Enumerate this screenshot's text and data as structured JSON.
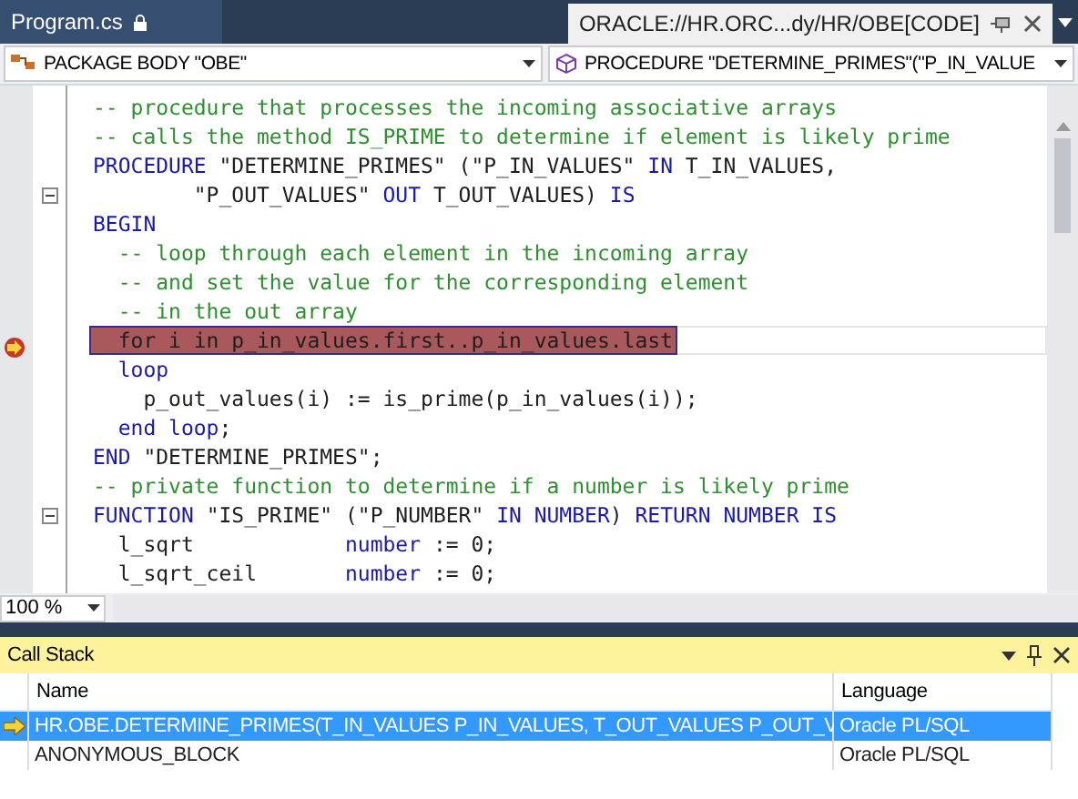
{
  "tabs": [
    {
      "label": "Program.cs",
      "selected": false,
      "locked": true
    },
    {
      "label": "ORACLE://HR.ORC...dy/HR/OBE[CODE]",
      "selected": true,
      "locked": false
    }
  ],
  "navigation": {
    "left": "PACKAGE BODY \"OBE\"",
    "right": "PROCEDURE \"DETERMINE_PRIMES\"(\"P_IN_VALUE"
  },
  "code_lines": [
    {
      "tokens": [
        {
          "kind": "comment",
          "text": "-- procedure that processes the incoming associative arrays"
        }
      ]
    },
    {
      "tokens": [
        {
          "kind": "comment",
          "text": "-- calls the method IS_PRIME to determine if element is likely prime"
        }
      ]
    },
    {
      "tokens": [
        {
          "kind": "keyword",
          "text": "PROCEDURE"
        },
        {
          "kind": "plain",
          "text": " \"DETERMINE_PRIMES\" (\"P_IN_VALUES\" "
        },
        {
          "kind": "keyword",
          "text": "IN"
        },
        {
          "kind": "plain",
          "text": " T_IN_VALUES,"
        }
      ]
    },
    {
      "fold": true,
      "tokens": [
        {
          "kind": "plain",
          "text": "        \"P_OUT_VALUES\" "
        },
        {
          "kind": "keyword",
          "text": "OUT"
        },
        {
          "kind": "plain",
          "text": " T_OUT_VALUES) "
        },
        {
          "kind": "keyword",
          "text": "IS"
        }
      ]
    },
    {
      "tokens": [
        {
          "kind": "keyword",
          "text": "BEGIN"
        }
      ]
    },
    {
      "tokens": [
        {
          "kind": "comment",
          "text": "  -- loop through each element in the incoming array"
        }
      ]
    },
    {
      "tokens": [
        {
          "kind": "comment",
          "text": "  -- and set the value for the corresponding element"
        }
      ]
    },
    {
      "tokens": [
        {
          "kind": "comment",
          "text": "  -- in the out array"
        }
      ]
    },
    {
      "current": true,
      "tokens": [
        {
          "kind": "plain",
          "text": "  for i in p_in_values.first..p_in_values.last"
        }
      ]
    },
    {
      "tokens": [
        {
          "kind": "keyword",
          "text": "  loop"
        }
      ]
    },
    {
      "tokens": [
        {
          "kind": "plain",
          "text": "    p_out_values(i) := is_prime(p_in_values(i));"
        }
      ]
    },
    {
      "tokens": [
        {
          "kind": "keyword",
          "text": "  end loop"
        },
        {
          "kind": "plain",
          "text": ";"
        }
      ]
    },
    {
      "tokens": [
        {
          "kind": "keyword",
          "text": "END"
        },
        {
          "kind": "plain",
          "text": " \"DETERMINE_PRIMES\";"
        }
      ]
    },
    {
      "tokens": [
        {
          "kind": "comment",
          "text": "-- private function to determine if a number is likely prime"
        }
      ]
    },
    {
      "fold": true,
      "tokens": [
        {
          "kind": "keyword",
          "text": "FUNCTION"
        },
        {
          "kind": "plain",
          "text": " \"IS_PRIME\" (\"P_NUMBER\" "
        },
        {
          "kind": "keyword",
          "text": "IN NUMBER"
        },
        {
          "kind": "plain",
          "text": ") "
        },
        {
          "kind": "keyword",
          "text": "RETURN NUMBER IS"
        }
      ]
    },
    {
      "tokens": [
        {
          "kind": "plain",
          "text": "  l_sqrt            "
        },
        {
          "kind": "keyword",
          "text": "number"
        },
        {
          "kind": "plain",
          "text": " := 0;"
        }
      ]
    },
    {
      "tokens": [
        {
          "kind": "plain",
          "text": "  l_sqrt_ceil       "
        },
        {
          "kind": "keyword",
          "text": "number"
        },
        {
          "kind": "plain",
          "text": " := 0;"
        }
      ]
    }
  ],
  "zoom": "100 %",
  "call_stack": {
    "title": "Call Stack",
    "columns": [
      "Name",
      "Language"
    ],
    "rows": [
      {
        "name": "HR.OBE.DETERMINE_PRIMES(T_IN_VALUES P_IN_VALUES, T_OUT_VALUES P_OUT_V",
        "language": "Oracle PL/SQL",
        "selected": true,
        "current": true
      },
      {
        "name": "ANONYMOUS_BLOCK",
        "language": "Oracle PL/SQL",
        "selected": false,
        "current": false
      }
    ]
  }
}
